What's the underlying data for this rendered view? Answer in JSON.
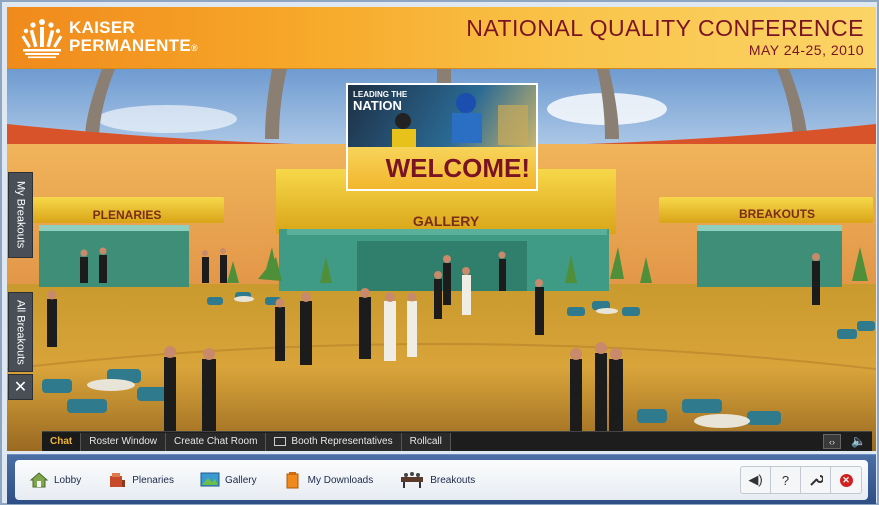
{
  "header": {
    "logo_line1": "KAISER",
    "logo_line2": "PERMANENTE",
    "logo_mark_suffix": "®",
    "title": "NATIONAL QUALITY CONFERENCE",
    "date": "MAY 24-25, 2010"
  },
  "scene": {
    "banner_lead_small": "LEADING THE",
    "banner_lead_big": "NATION",
    "banner_welcome": "WELCOME!",
    "signs": {
      "plenaries": "PLENARIES",
      "gallery": "GALLERY",
      "breakouts": "BREAKOUTS"
    }
  },
  "side_tabs": {
    "my_breakouts": "My Breakouts",
    "all_breakouts": "All Breakouts",
    "close": "✕"
  },
  "chatbar": {
    "tabs": [
      "Chat",
      "Roster Window",
      "Create Chat Room",
      "Booth Representatives",
      "Rollcall"
    ],
    "active_tab": "Chat"
  },
  "bottom_nav": {
    "items": [
      {
        "label": "Lobby",
        "icon": "lobby-icon"
      },
      {
        "label": "Plenaries",
        "icon": "plenaries-icon"
      },
      {
        "label": "Gallery",
        "icon": "gallery-icon"
      },
      {
        "label": "My Downloads",
        "icon": "downloads-icon"
      },
      {
        "label": "Breakouts",
        "icon": "breakouts-icon"
      }
    ],
    "tools": [
      {
        "icon": "volume-icon",
        "glyph": "◀)"
      },
      {
        "icon": "help-icon",
        "glyph": "?"
      },
      {
        "icon": "settings-wrench-icon",
        "glyph": "🔧"
      },
      {
        "icon": "exit-icon",
        "glyph": "✕"
      }
    ]
  },
  "colors": {
    "header_orange": "#f08a1c",
    "title_maroon": "#7a1424",
    "nav_blue": "#2e4f86",
    "chat_active": "#f0b43a"
  }
}
